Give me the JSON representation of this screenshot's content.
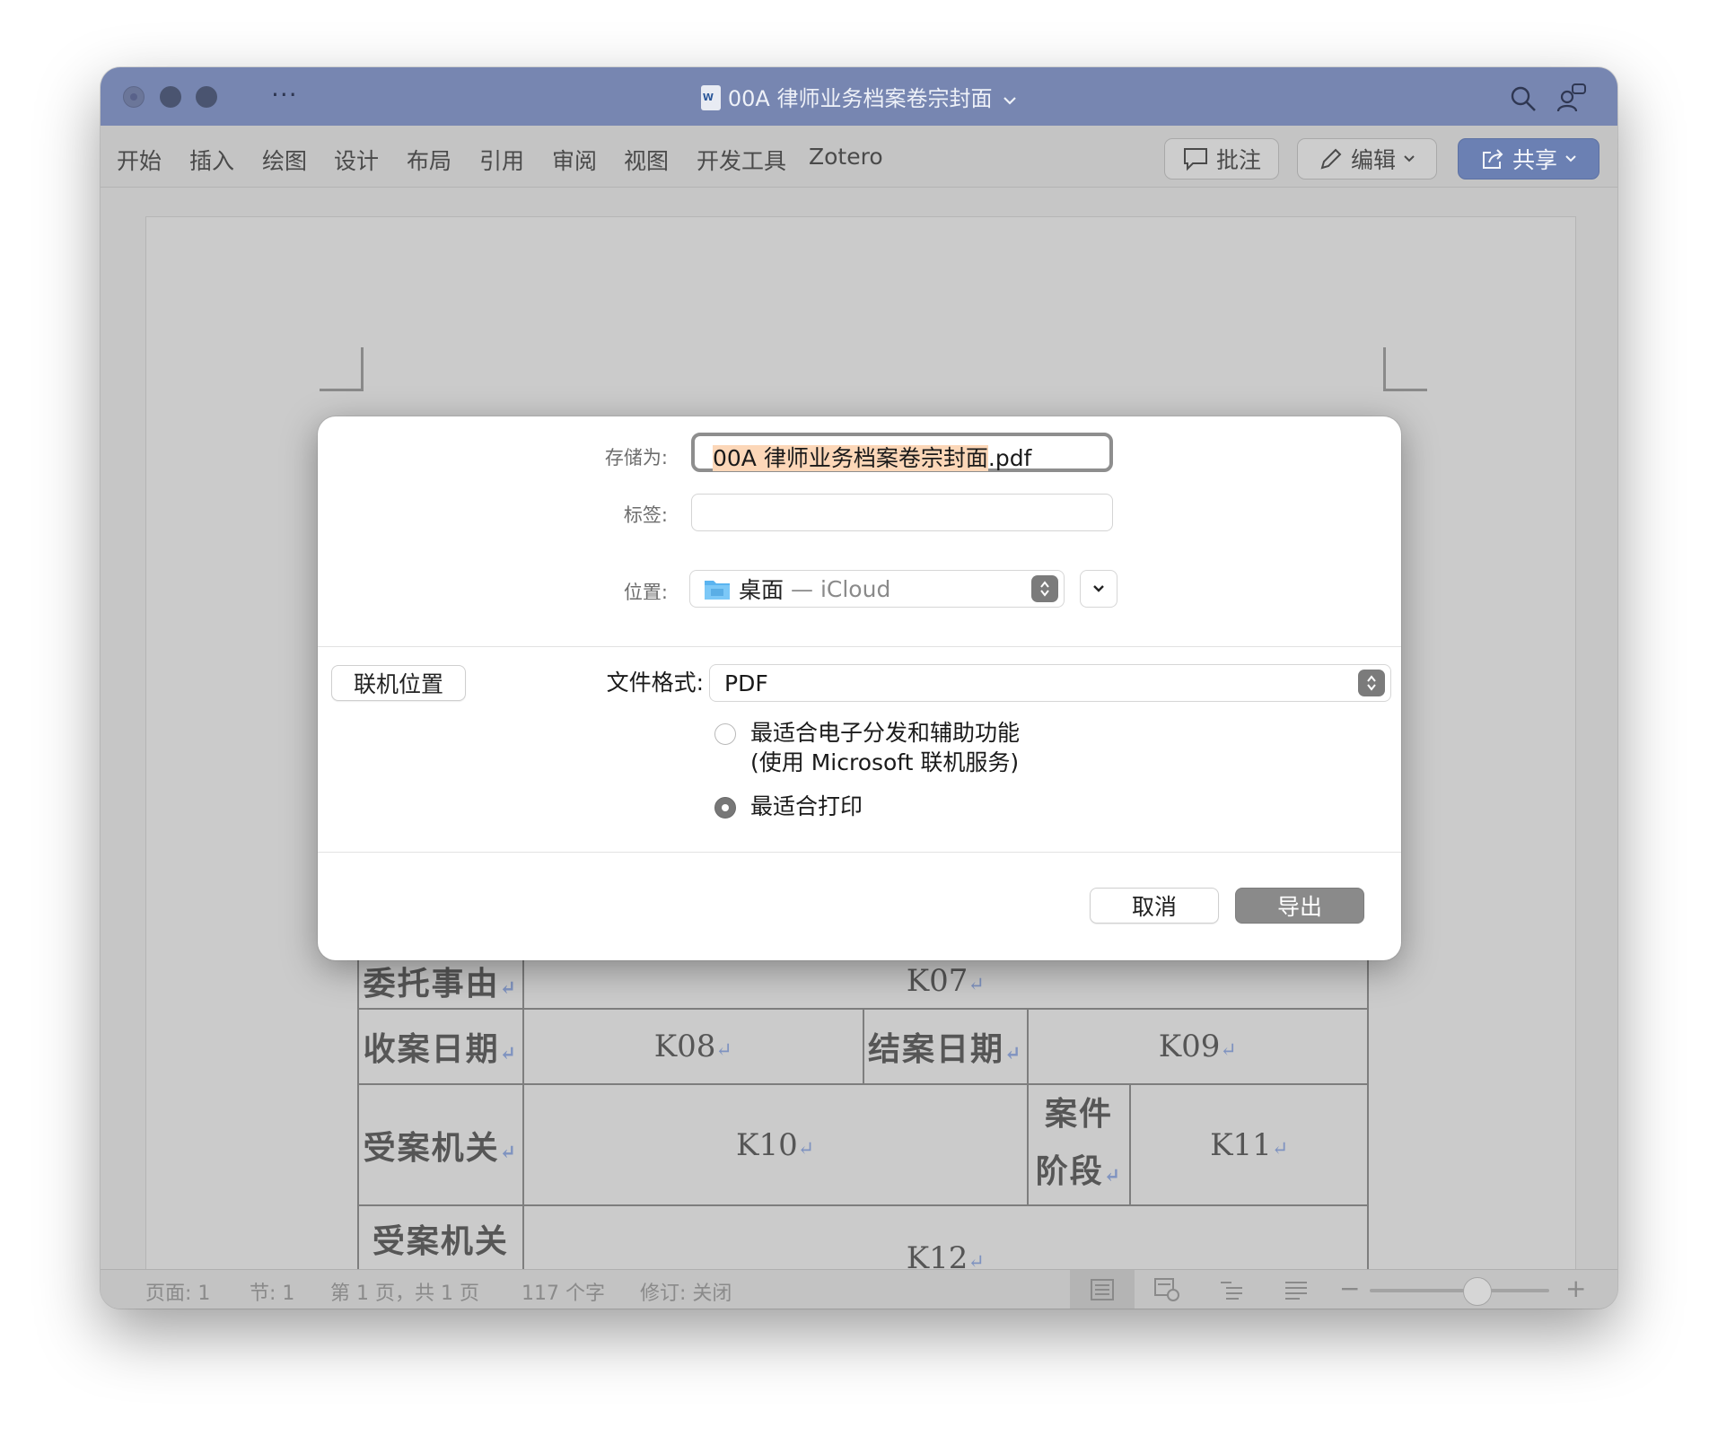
{
  "window": {
    "title": "00A 律师业务档案卷宗封面",
    "more_label": "···"
  },
  "ribbon": {
    "tabs": [
      "开始",
      "插入",
      "绘图",
      "设计",
      "布局",
      "引用",
      "审阅",
      "视图",
      "开发工具",
      "Zotero"
    ],
    "comments_label": "批注",
    "editing_label": "编辑",
    "share_label": "共享"
  },
  "document": {
    "rows": {
      "r1_label": "委托事由",
      "r1_value": "K07",
      "r2_label_a": "收案日期",
      "r2_value_a": "K08",
      "r2_label_b": "结案日期",
      "r2_value_b": "K09",
      "r3_label_a": "受案机关",
      "r3_value_a": "K10",
      "r3_label_b_line1": "案件",
      "r3_label_b_line2": "阶段",
      "r3_value_b": "K11",
      "r4_label": "受案机关",
      "r4_value": "K12"
    },
    "paragraph_mark": "↵"
  },
  "statusbar": {
    "page": "页面: 1",
    "section": "节: 1",
    "page_count": "第 1 页，共 1 页",
    "word_count": "117 个字",
    "track_changes": "修订: 关闭",
    "zoom_minus": "−",
    "zoom_plus": "+",
    "zoom_level": 0.6
  },
  "dialog": {
    "save_as_label": "存储为:",
    "filename_selected": "00A 律师业务档案卷宗封面",
    "filename_ext": ".pdf",
    "tags_label": "标签:",
    "tags_value": "",
    "location_label": "位置:",
    "location_value": "桌面",
    "location_sub": "— iCloud",
    "online_locations_button": "联机位置",
    "file_format_label": "文件格式:",
    "file_format_value": "PDF",
    "option1_line1": "最适合电子分发和辅助功能",
    "option1_line2": "(使用 Microsoft 联机服务)",
    "option2": "最适合打印",
    "selected_option": "option2",
    "cancel_button": "取消",
    "export_button": "导出"
  },
  "colors": {
    "titlebar": "#7786b1",
    "share_button": "#6b80b3",
    "filename_highlight": "#fcd7b8",
    "primary_button": "#8a8a8a"
  }
}
